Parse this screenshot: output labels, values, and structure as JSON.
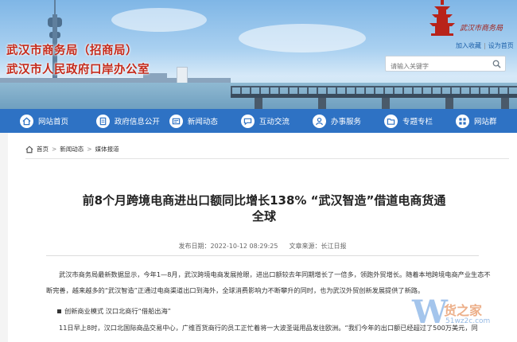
{
  "header": {
    "title_line1": "武汉市商务局（招商局）",
    "title_line2": "武汉市人民政府口岸办公室",
    "logo_text": "武汉市商务局",
    "top_links": {
      "accessibility": "加入收藏",
      "homepage": "设为首页"
    },
    "search": {
      "placeholder": "请输入关键字"
    }
  },
  "nav": {
    "items": [
      {
        "label": "网站首页",
        "icon": "home-icon"
      },
      {
        "label": "政府信息公开",
        "icon": "document-icon"
      },
      {
        "label": "新闻动态",
        "icon": "news-icon"
      },
      {
        "label": "互动交流",
        "icon": "chat-icon"
      },
      {
        "label": "办事服务",
        "icon": "user-icon"
      },
      {
        "label": "专题专栏",
        "icon": "folder-icon"
      },
      {
        "label": "网站群",
        "icon": "grid-icon"
      }
    ]
  },
  "breadcrumb": {
    "items": [
      "首页",
      "新闻动态",
      "媒体报道"
    ],
    "separator": ">"
  },
  "article": {
    "title_line1": "前8个月跨境电商进出口额同比增长138% “武汉智造”借道电商货通",
    "title_line2": "全球",
    "publish_label": "发布日期：",
    "publish_time": "2022-10-12 08:29:25",
    "source_label": "文章来源：",
    "source": "长江日报",
    "paragraph1": "武汉市商务局最新数据显示，今年1—8月，武汉跨境电商发展抢眼，进出口额较去年同期增长了一倍多，领跑外贸增长。随着本地跨境电商产业生态不断完善，越来越多的“武汉智造”正通过电商渠道出口到海外，全球消费影响力不断攀升的同时，也为武汉外贸创新发展提供了新路。",
    "subheading": "创新商业模式 汉口北商行“借船出海”",
    "paragraph2": "11日早上8时，汉口北国际商品交易中心，广维百货商行的员工正忙着将一大波圣诞用品发往欧洲。“我们今年的出口额已经超过了500万美元，同"
  },
  "watermark": {
    "glyph": "W",
    "cn": "货之家",
    "en": "51wz2c.com"
  },
  "colors": {
    "nav": "#2e72c4",
    "title_red": "#c42a1b",
    "link": "#1b5fa8"
  }
}
